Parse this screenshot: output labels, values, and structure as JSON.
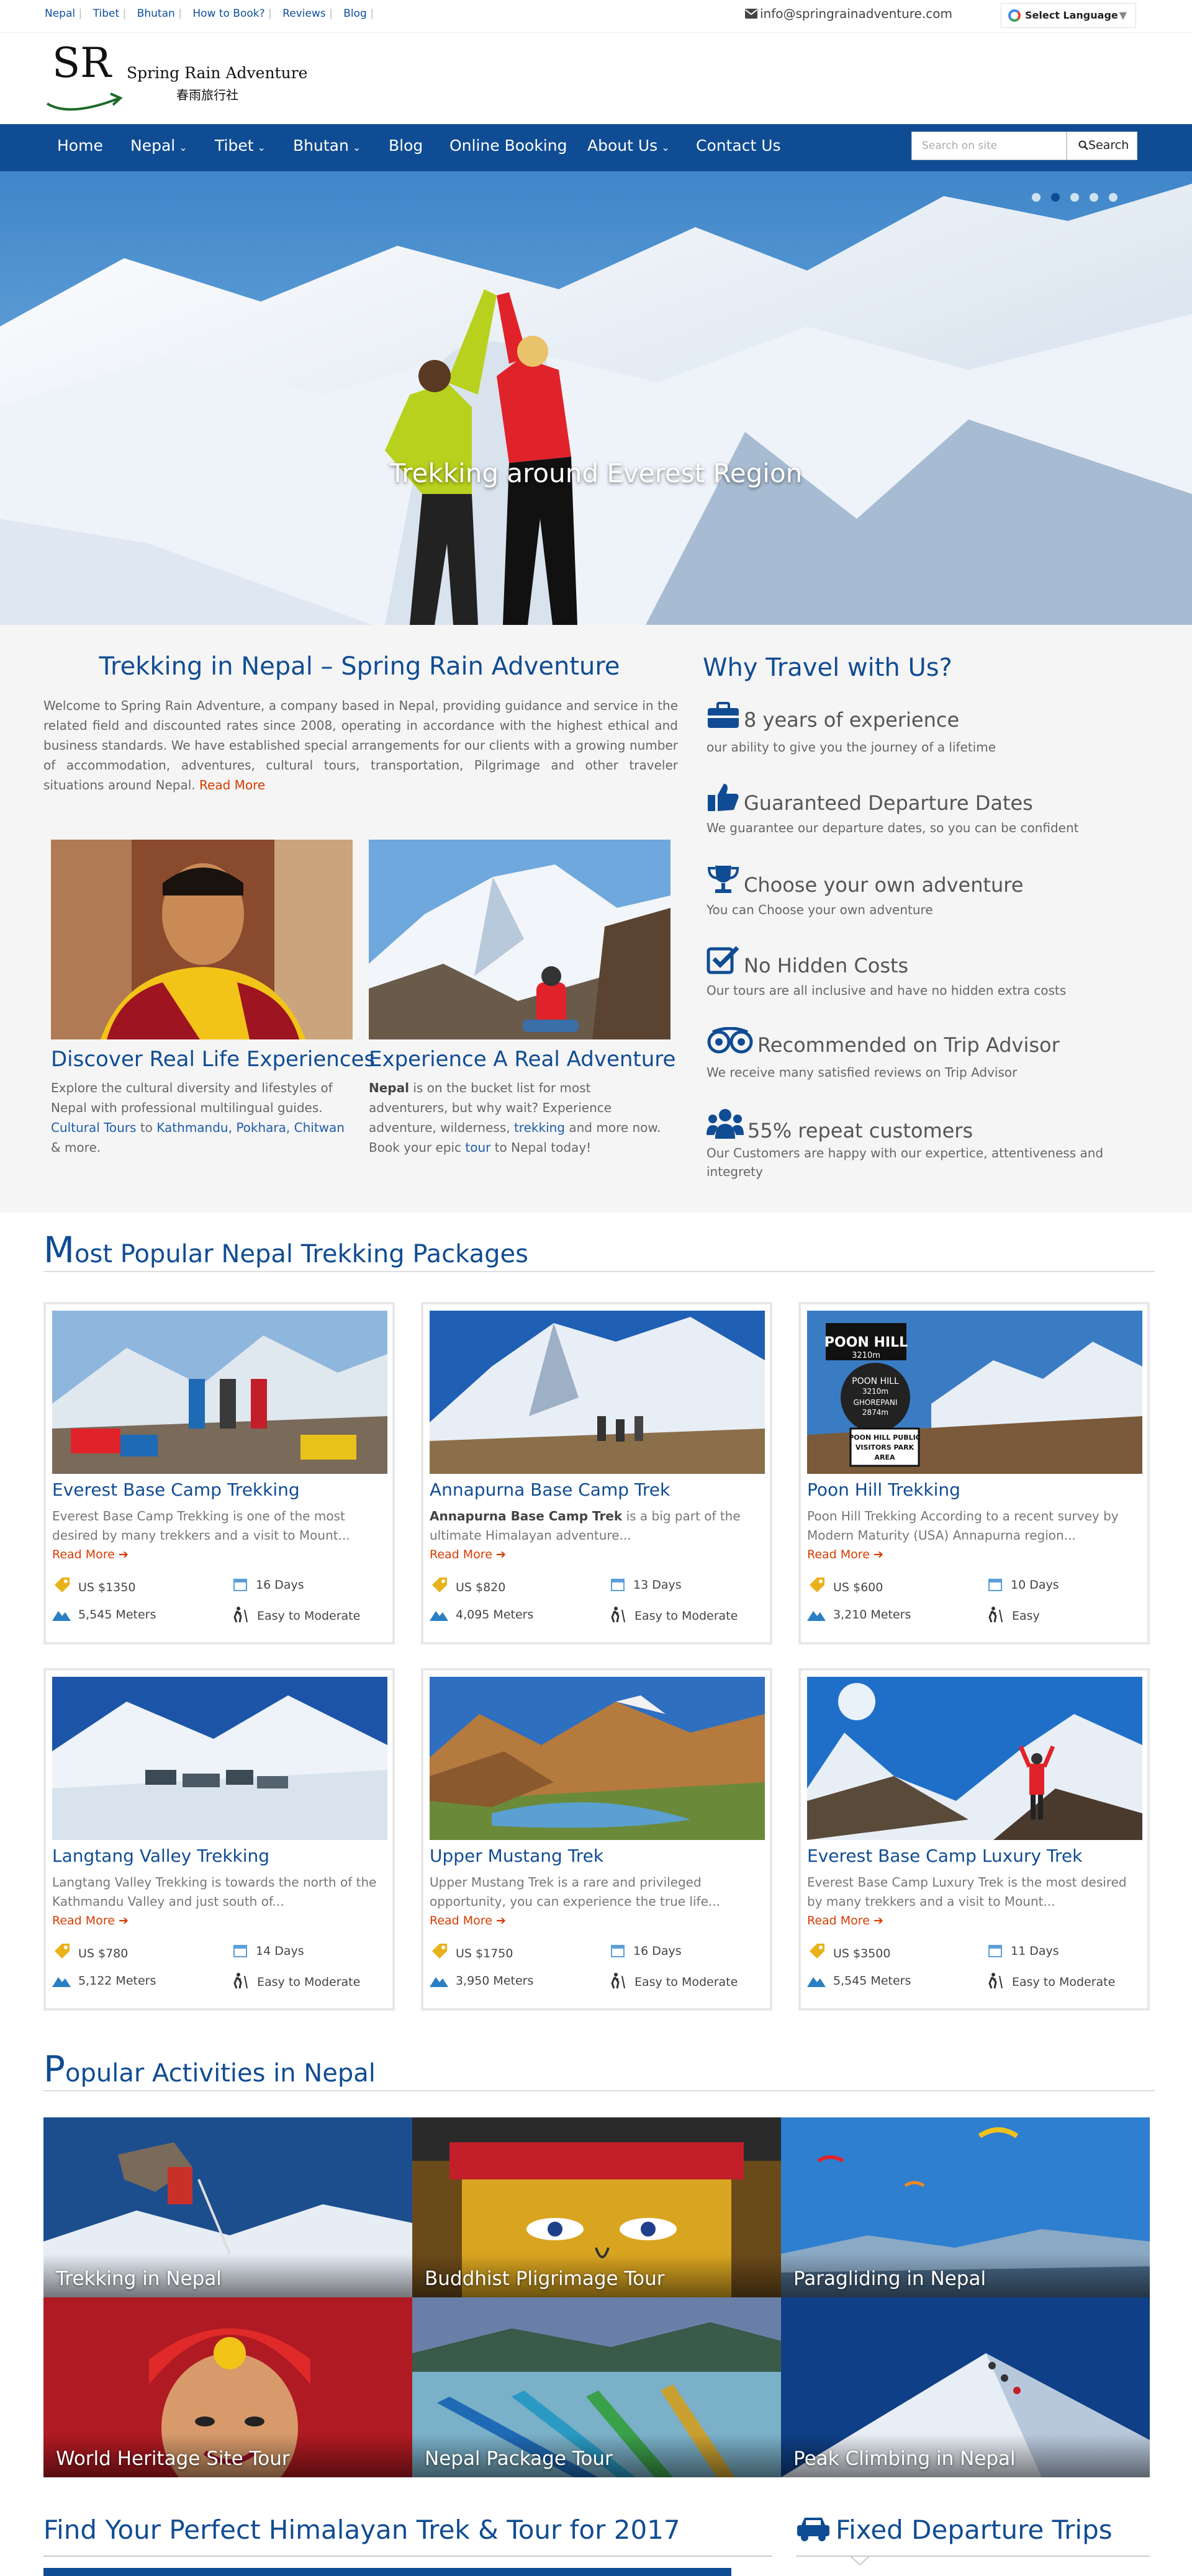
{
  "topbar": {
    "links": [
      "Nepal",
      "Tibet",
      "Bhutan",
      "How to Book?",
      "Reviews",
      "Blog"
    ],
    "email": "info@springrainadventure.com",
    "language": "Select Language"
  },
  "logo": {
    "mark": "SR",
    "name": "Spring Rain Adventure",
    "chinese": "春雨旅行社"
  },
  "nav": {
    "items": [
      "Home",
      "Nepal",
      "Tibet",
      "Bhutan",
      "Blog",
      "Online Booking",
      "About Us",
      "Contact Us"
    ],
    "search_placeholder": "Search on site",
    "search_button": "Search"
  },
  "hero": {
    "caption": "Trekking around Everest Region",
    "slide_count": 5,
    "active_slide": 1
  },
  "intro": {
    "title": "Trekking in Nepal – Spring Rain Adventure",
    "text": "Welcome to Spring Rain Adventure, a company based in Nepal, providing guidance and service in the related field and discounted rates since 2008, operating in accordance with the highest ethical and business standards. We have established special arrangements for our clients with a growing number of accommodation, adventures, cultural tours, transportation, Pilgrimage and other traveler situations around Nepal.",
    "read_more": "Read More",
    "feature1": {
      "title": "Discover Real Life Experiences",
      "text1": "Explore the cultural diversity and lifestyles of Nepal with professional multilingual guides.",
      "link1": "Cultural Tours",
      "to": "to",
      "link2": "Kathmandu",
      "comma": ",",
      "link3": "Pokhara",
      "link4": "Chitwan",
      "end": "& more."
    },
    "feature2": {
      "title": "Experience A Real Adventure",
      "bold": "Nepal",
      "text1": "is on the bucket list for most adventurers, but why wait? Experience adventure, wilderness,",
      "link1": "trekking",
      "text2": "and more now. Book your epic",
      "link2": "tour",
      "text3": "to Nepal today!"
    }
  },
  "why": {
    "title": "Why Travel with Us?",
    "items": [
      {
        "icon": "briefcase-icon",
        "head": "8 years of experience",
        "sub": "our ability to give you the journey of a lifetime"
      },
      {
        "icon": "thumbs-up-icon",
        "head": "Guaranteed Departure Dates",
        "sub": "We guarantee our departure dates, so you can be confident"
      },
      {
        "icon": "trophy-icon",
        "head": "Choose your own adventure",
        "sub": "You can Choose your own adventure"
      },
      {
        "icon": "checkbox-icon",
        "head": "No Hidden Costs",
        "sub": "Our tours are all inclusive and have no hidden extra costs"
      },
      {
        "icon": "tripadvisor-icon",
        "head": "Recommended on Trip Advisor",
        "sub": "We receive many satisfied reviews on Trip Advisor"
      },
      {
        "icon": "users-icon",
        "head": "55% repeat customers",
        "sub": "Our Customers are happy with our expertice, attentiveness and integrety"
      }
    ]
  },
  "packages": {
    "title_first": "M",
    "title_rest": "ost Popular Nepal Trekking Packages",
    "read_more": "Read More",
    "items": [
      {
        "title": "Everest Base Camp Trekking",
        "bold": "",
        "desc": "Everest Base Camp Trekking is one of the most desired by many trekkers and a visit to Mount...",
        "price": "US $1350",
        "days": "16 Days",
        "altitude": "5,545 Meters",
        "grade": "Easy to Moderate"
      },
      {
        "title": "Annapurna Base Camp Trek",
        "bold": "Annapurna Base Camp Trek",
        "desc": " is a big part of the ultimate Himalayan adventure...",
        "price": "US $820",
        "days": "13 Days",
        "altitude": "4,095 Meters",
        "grade": "Easy to Moderate"
      },
      {
        "title": "Poon Hill Trekking",
        "bold": "",
        "desc": "Poon Hill Trekking  According to a recent survey by Modern Maturity (USA) Annapurna region...",
        "price": "US $600",
        "days": "10 Days",
        "altitude": "3,210 Meters",
        "grade": "Easy"
      },
      {
        "title": "Langtang Valley Trekking",
        "bold": "",
        "desc": "Langtang Valley Trekking is towards the north of the Kathmandu Valley and just south of...",
        "price": "US $780",
        "days": "14 Days",
        "altitude": "5,122 Meters",
        "grade": "Easy to Moderate"
      },
      {
        "title": "Upper Mustang Trek",
        "bold": "",
        "desc": "Upper Mustang Trek is a rare and privileged opportunity, you can experience the true life...",
        "price": "US $1750",
        "days": "16 Days",
        "altitude": "3,950 Meters",
        "grade": "Easy to Moderate"
      },
      {
        "title": "Everest Base Camp Luxury Trek",
        "bold": "",
        "desc": "Everest Base Camp Luxury Trek is the most desired by many trekkers and a visit to Mount...",
        "price": "US $3500",
        "days": "11 Days",
        "altitude": "5,545 Meters",
        "grade": "Easy to Moderate"
      }
    ],
    "poon_sign": {
      "l1": "POON HILL",
      "l2": "3210m",
      "l3": "POON HILL",
      "l4": "3210m",
      "l5": "GHOREPANI",
      "l6": "2874m",
      "l7": "POON HILL PUBLIC",
      "l8": "VISITORS PARK",
      "l9": "AREA"
    }
  },
  "activities": {
    "title_first": "P",
    "title_rest": "opular Activities in Nepal",
    "items": [
      "Trekking in Nepal",
      "Buddhist Pligrimage Tour",
      "Paragliding in Nepal",
      "World Heritage Site Tour",
      "Nepal Package Tour",
      "Peak Climbing in Nepal"
    ]
  },
  "bottom": {
    "left_title": "Find Your Perfect Himalayan Trek & Tour for 2017",
    "right_title": "Fixed Departure Trips"
  },
  "colors": {
    "brand": "#104c93",
    "accent": "#d63b00",
    "bg_light": "#f5f5f5"
  }
}
